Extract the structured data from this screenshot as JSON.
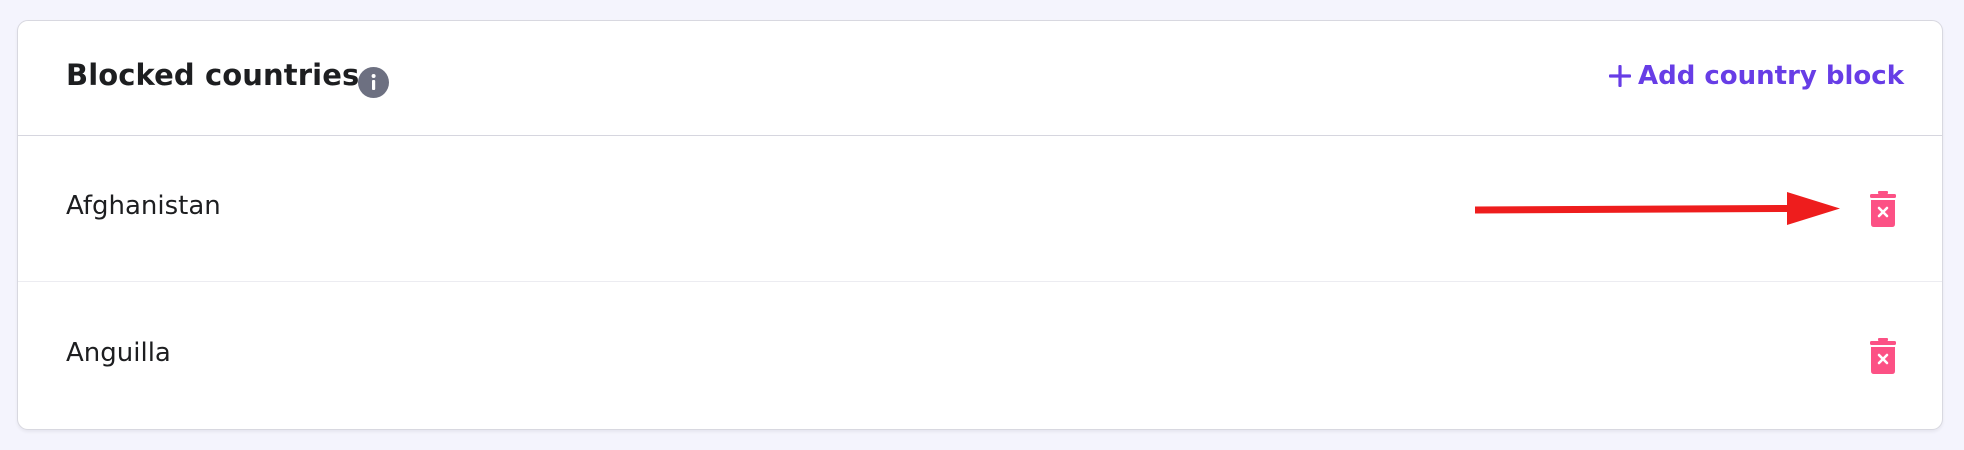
{
  "section": {
    "title": "Blocked countries",
    "info_icon": "info-icon",
    "add_label": "Add country block",
    "add_icon": "plus-icon"
  },
  "countries": [
    {
      "name": "Afghanistan",
      "delete_icon": "trash-icon"
    },
    {
      "name": "Anguilla",
      "delete_icon": "trash-icon"
    }
  ],
  "annotation": {
    "type": "arrow",
    "color": "#ee1d1d",
    "points_to": "delete Afghanistan"
  },
  "colors": {
    "accent": "#673de6",
    "danger": "#fc5185",
    "text": "#1d1e20",
    "info_icon_bg": "#6d7081",
    "page_bg": "#f4f4fd"
  }
}
